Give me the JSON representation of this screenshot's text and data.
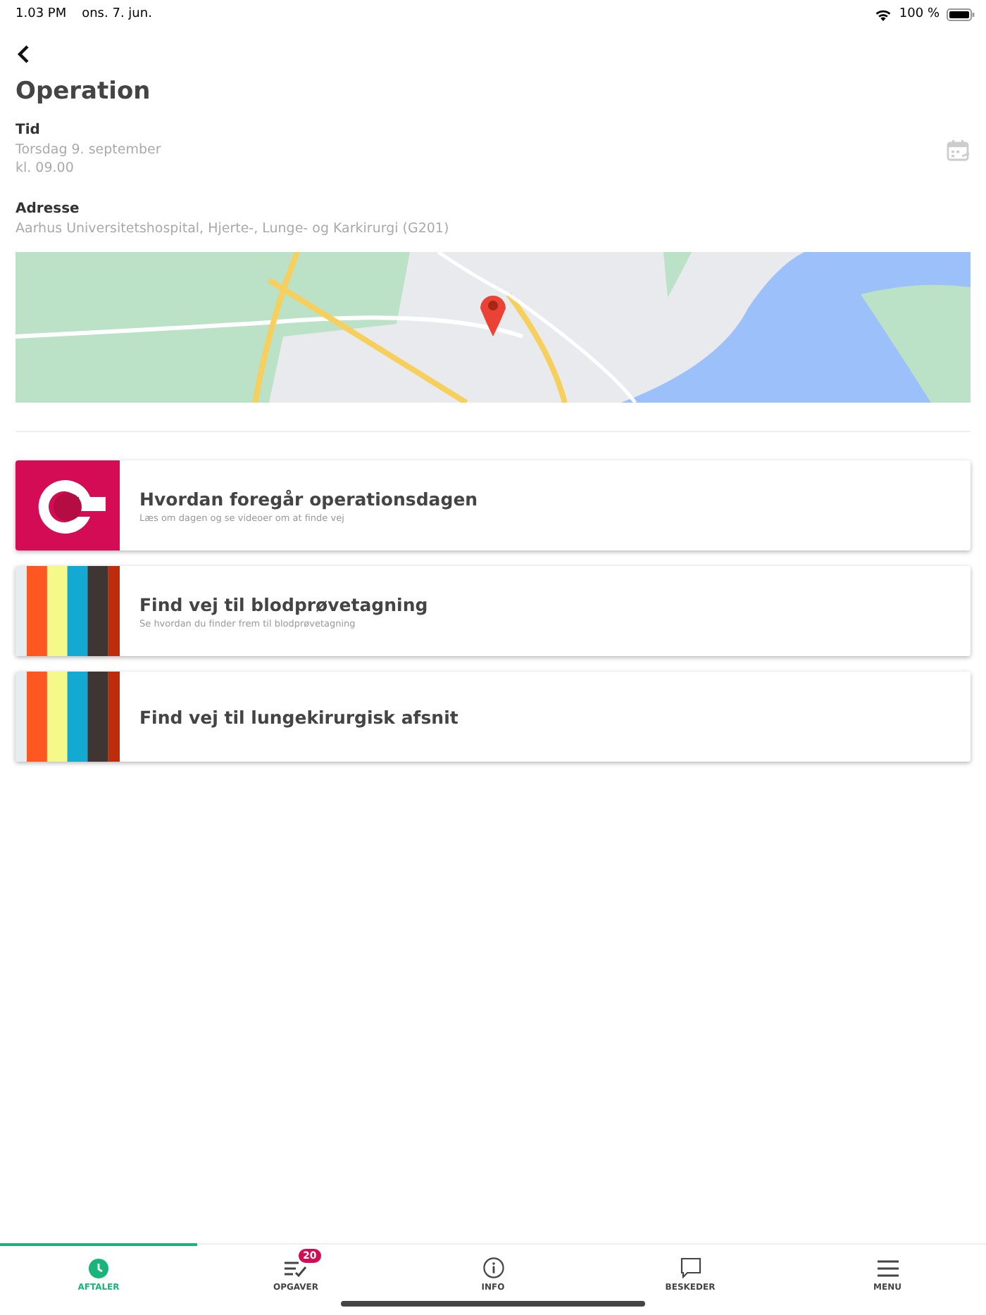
{
  "status_bar": {
    "time": "1.03 PM",
    "date": "ons. 7. jun.",
    "battery": "100 %"
  },
  "title": "Operation",
  "time_section": {
    "label": "Tid",
    "lines": [
      "Torsdag 9. september",
      "kl. 09.00"
    ]
  },
  "address_section": {
    "label": "Adresse",
    "value": "Aarhus Universitetshospital, Hjerte-, Lunge- og Karkirurgi (G201)"
  },
  "cards": [
    {
      "kind": "logo",
      "title": "Hvordan foregår operationsdagen",
      "subtitle": "Læs om dagen og se videoer om at finde vej"
    },
    {
      "kind": "stripes",
      "title": "Find vej til blodprøvetagning",
      "subtitle": "Se hvordan du finder frem til blodprøvetagning"
    },
    {
      "kind": "stripes",
      "title": "Find vej til lungekirurgisk afsnit"
    }
  ],
  "tab_bar": [
    {
      "kind": "clock",
      "label": "AFTALER",
      "selected": true
    },
    {
      "kind": "tasks",
      "label": "OPGAVER",
      "selected": false,
      "badge": "20"
    },
    {
      "kind": "info",
      "label": "INFO",
      "selected": false
    },
    {
      "kind": "chat",
      "label": "BESKEDER",
      "selected": false
    },
    {
      "kind": "menu",
      "label": "MENU",
      "selected": false
    }
  ]
}
